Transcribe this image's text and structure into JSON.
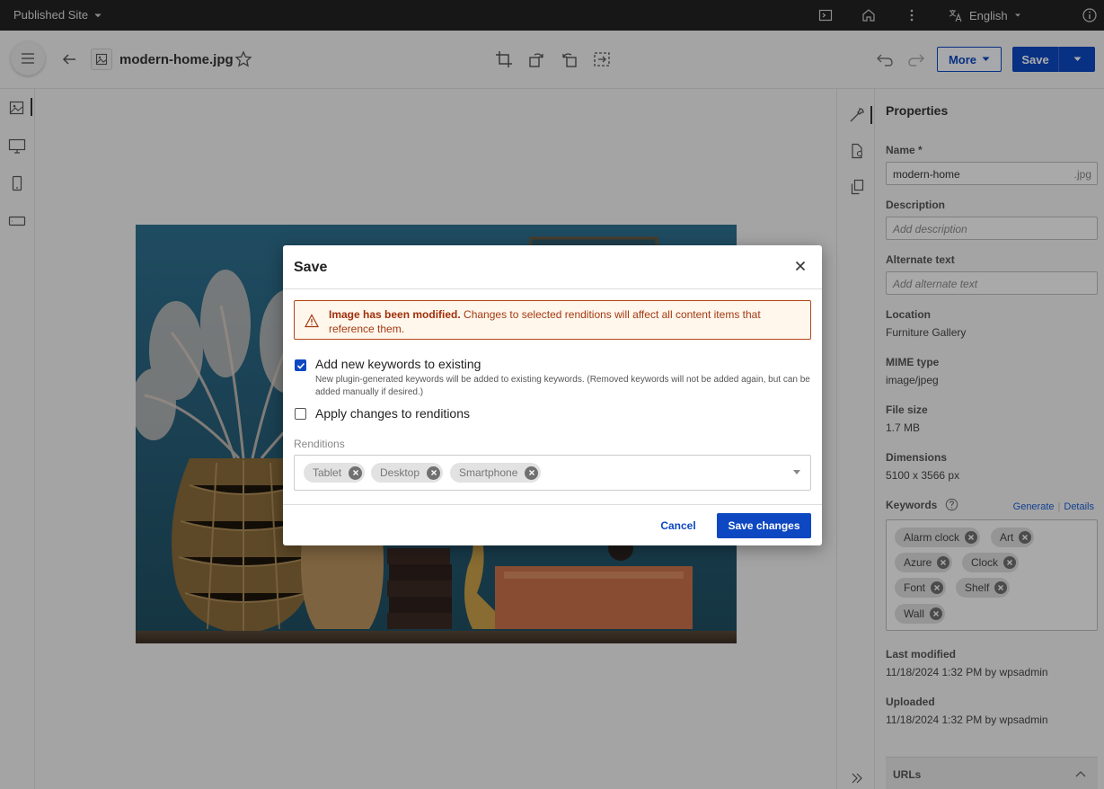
{
  "topbar": {
    "site_label": "Published Site",
    "language": "English",
    "icons": [
      "preview-icon",
      "home-icon",
      "more-vertical-icon",
      "translate-icon",
      "info-icon"
    ]
  },
  "toolbar": {
    "filename": "modern-home.jpg",
    "more_label": "More",
    "save_label": "Save",
    "icons": [
      "hamburger-icon",
      "back-arrow-icon",
      "image-file-icon",
      "star-icon",
      "crop-icon",
      "rotate-left-icon",
      "rotate-right-icon",
      "resize-icon",
      "undo-icon",
      "redo-icon"
    ]
  },
  "left_rail": {
    "icons": [
      "image-icon",
      "desktop-icon",
      "phone-icon",
      "tablet-icon"
    ]
  },
  "right_rail": {
    "icons": [
      "wrench-icon",
      "file-settings-icon",
      "copy-icon",
      "collapse-double-chevron-icon"
    ]
  },
  "properties": {
    "title": "Properties",
    "name_label": "Name *",
    "name_value": "modern-home",
    "name_suffix": ".jpg",
    "description_label": "Description",
    "description_placeholder": "Add description",
    "alt_label": "Alternate text",
    "alt_placeholder": "Add alternate text",
    "location_label": "Location",
    "location_value": "Furniture Gallery",
    "mime_label": "MIME type",
    "mime_value": "image/jpeg",
    "size_label": "File size",
    "size_value": "1.7 MB",
    "dimensions_label": "Dimensions",
    "dimensions_value": "5100 x 3566 px",
    "keywords_label": "Keywords",
    "generate_link": "Generate",
    "details_link": "Details",
    "keywords": [
      "Alarm clock",
      "Art",
      "Azure",
      "Clock",
      "Font",
      "Shelf",
      "Wall"
    ],
    "last_modified_label": "Last modified",
    "last_modified_value": "11/18/2024 1:32 PM by wpsadmin",
    "uploaded_label": "Uploaded",
    "uploaded_value": "11/18/2024 1:32 PM by wpsadmin",
    "urls_label": "URLs"
  },
  "modal": {
    "title": "Save",
    "alert_bold": "Image has been modified.",
    "alert_text": " Changes to selected renditions will affect all content items that reference them.",
    "keywords_checkbox_label": "Add new keywords to existing",
    "keywords_checkbox_checked": true,
    "keywords_help": "New plugin-generated keywords will be added to existing keywords. (Removed keywords will not be added again, but can be added manually if desired.)",
    "renditions_checkbox_label": "Apply changes to renditions",
    "renditions_checkbox_checked": false,
    "renditions_label": "Renditions",
    "renditions": [
      "Tablet",
      "Desktop",
      "Smartphone"
    ],
    "cancel_label": "Cancel",
    "save_label": "Save changes"
  },
  "colors": {
    "primary": "#0d47c2",
    "alert_border": "#b3461a",
    "alert_bg": "#fff6ec",
    "topbar_bg": "#232323"
  }
}
